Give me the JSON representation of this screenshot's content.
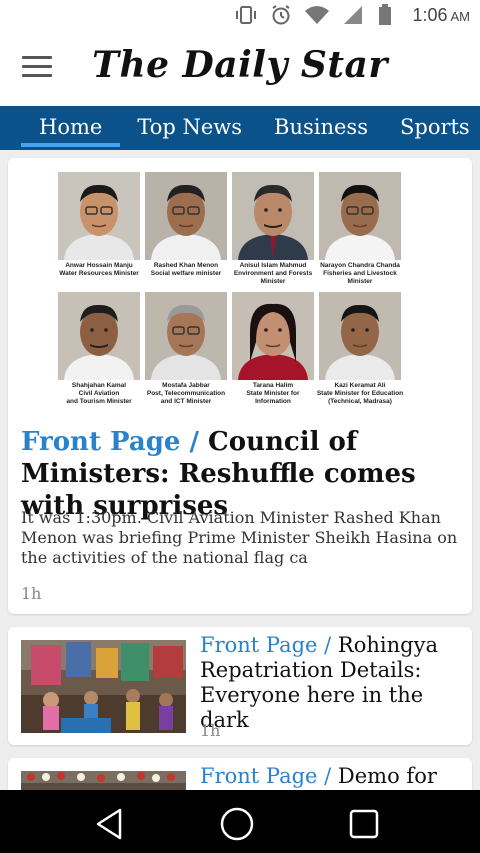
{
  "status_bar": {
    "time": "1:06",
    "ampm": "AM",
    "icons": [
      "vibrate-icon",
      "alarm-icon",
      "wifi-icon",
      "signal-icon",
      "battery-icon"
    ]
  },
  "app_bar": {
    "logo_text": "The Daily Star",
    "menu_icon": "hamburger-menu-icon"
  },
  "tabs": [
    {
      "label": "Home",
      "active": true
    },
    {
      "label": "Top News",
      "active": false
    },
    {
      "label": "Business",
      "active": false
    },
    {
      "label": "Sports",
      "active": false
    }
  ],
  "featured": {
    "section": "Front Page /",
    "title": "Council of Ministers: Reshuffle comes with surprises",
    "excerpt": "It was 1:30pm. Civil Aviation Minister Rashed Khan Menon was briefing Prime Minister Sheikh Hasina on the activities of the national flag ca",
    "age": "1h",
    "ministers": [
      {
        "caption": "Anwar Hossain Manju\nWater Resources Minister"
      },
      {
        "caption": "Rashed Khan Menon\nSocial welfare minister"
      },
      {
        "caption": "Anisul Islam Mahmud\nEnvironment and Forests\nMinister"
      },
      {
        "caption": "Narayon Chandra Chanda\nFisheries and Livestock\nMinister"
      },
      {
        "caption": "Shahjahan Kamal\nCivil Aviation\nand Tourism Minister"
      },
      {
        "caption": "Mostafa Jabbar\nPost, Telecommunication\nand ICT Minister"
      },
      {
        "caption": "Tarana Halim\nState Minister for\nInformation"
      },
      {
        "caption": "Kazi Keramat Ali\nState Minister for Education\n(Technical, Madrasa)"
      }
    ]
  },
  "articles": [
    {
      "section": "Front Page /",
      "title": "Rohingya Repatriation Details: Everyone here in the dark",
      "age": "1h"
    },
    {
      "section": "Front Page /",
      "title": "Demo for",
      "age": ""
    }
  ],
  "nav_bar": {
    "icons": [
      "back-icon",
      "home-icon",
      "recents-icon"
    ]
  },
  "colors": {
    "tab_bar": "#0a5289",
    "tab_indicator": "#4aa3ea",
    "section_label": "#2a82cc"
  }
}
